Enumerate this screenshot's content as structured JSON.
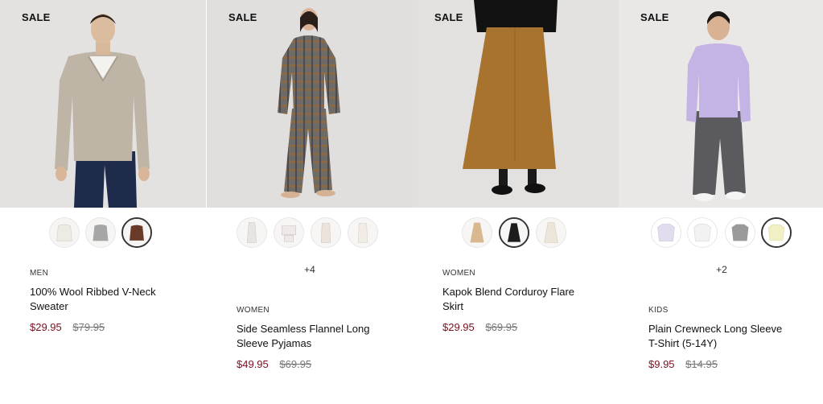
{
  "products": [
    {
      "badge": "SALE",
      "category": "MEN",
      "name_line1": "100% Wool Ribbed V-Neck",
      "name_line2": "Sweater",
      "price_now": "$29.95",
      "price_was": "$79.95",
      "more": "",
      "bg": "#e4e2e0",
      "swatch_colors": [
        "#eeeae4",
        "#a6a6a6",
        "#6a3a28"
      ],
      "selected_swatch": 2
    },
    {
      "badge": "SALE",
      "category": "WOMEN",
      "name_line1": "Side Seamless Flannel Long",
      "name_line2": "Sleeve Pyjamas",
      "price_now": "$49.95",
      "price_was": "$69.95",
      "more": "+4",
      "bg": "#e1dfde",
      "swatch_colors": [
        "#e7e5e3",
        "#efe9e9",
        "#ece3dc",
        "#f2ece6"
      ],
      "selected_swatch": -1
    },
    {
      "badge": "SALE",
      "category": "WOMEN",
      "name_line1": "Kapok Blend Corduroy Flare",
      "name_line2": "Skirt",
      "price_now": "$29.95",
      "price_was": "$69.95",
      "more": "",
      "bg": "#e3e1df",
      "swatch_colors": [
        "#d9b88f",
        "#1c1c1c",
        "#ece5d9"
      ],
      "selected_swatch": 1
    },
    {
      "badge": "SALE",
      "category": "KIDS",
      "name_line1": "Plain Crewneck Long Sleeve",
      "name_line2": "T-Shirt (5-14Y)",
      "price_now": "$9.95",
      "price_was": "$14.95",
      "more": "+2",
      "bg": "#e9e8e7",
      "swatch_colors": [
        "#e2dcef",
        "#f2f2f2",
        "#9a9a9a",
        "#f1f0c4"
      ],
      "selected_swatch": 3
    }
  ]
}
